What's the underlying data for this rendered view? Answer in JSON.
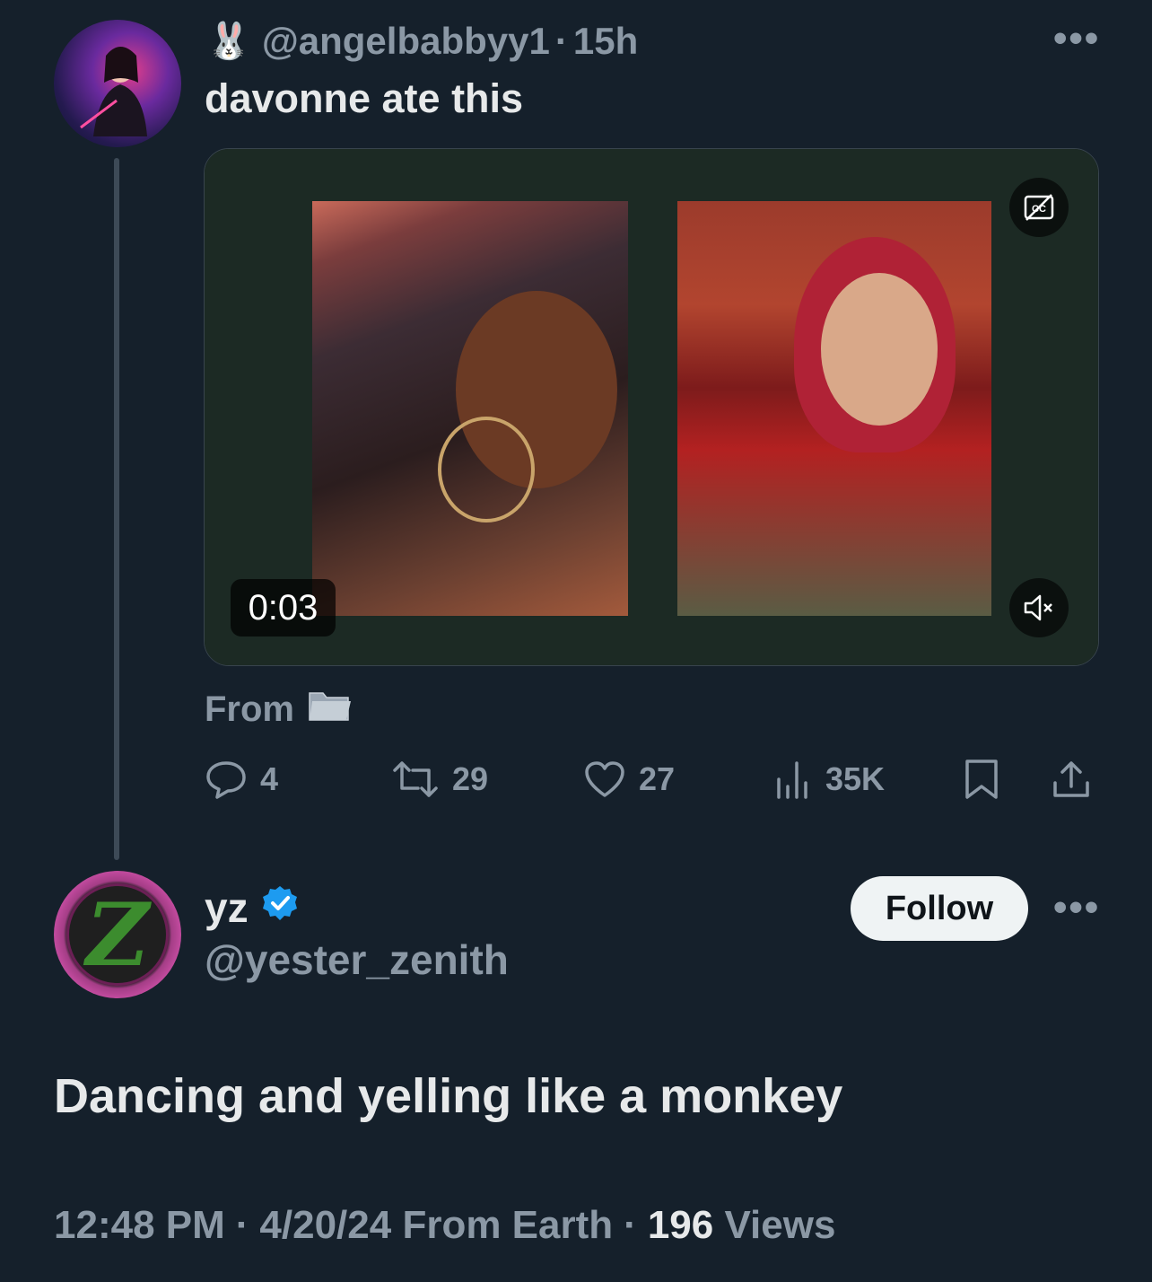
{
  "parent_tweet": {
    "emoji": "🐰",
    "handle": "@angelbabbyy1",
    "separator": "·",
    "time": "15h",
    "text": "davonne ate this",
    "more": "•••",
    "video": {
      "timestamp": "0:03",
      "cc_icon": "captions-off-icon",
      "mute_icon": "muted-speaker-icon"
    },
    "from_label": "From",
    "from_icon": "folder-icon",
    "actions": {
      "replies": "4",
      "retweets": "29",
      "likes": "27",
      "views": "35K"
    }
  },
  "reply_tweet": {
    "name": "yz",
    "verified": true,
    "handle": "@yester_zenith",
    "follow_label": "Follow",
    "more": "•••",
    "avatar_letter": "Z",
    "text": "Dancing and yelling like a monkey",
    "meta": {
      "time": "12:48 PM",
      "dot1": "·",
      "date_from": "4/20/24 From Earth",
      "dot2": "·",
      "views_count": "196",
      "views_label": "Views"
    }
  },
  "colors": {
    "background": "#15202b",
    "text": "#e7e9ea",
    "muted": "#8b98a5",
    "verified": "#1d9bf0"
  }
}
